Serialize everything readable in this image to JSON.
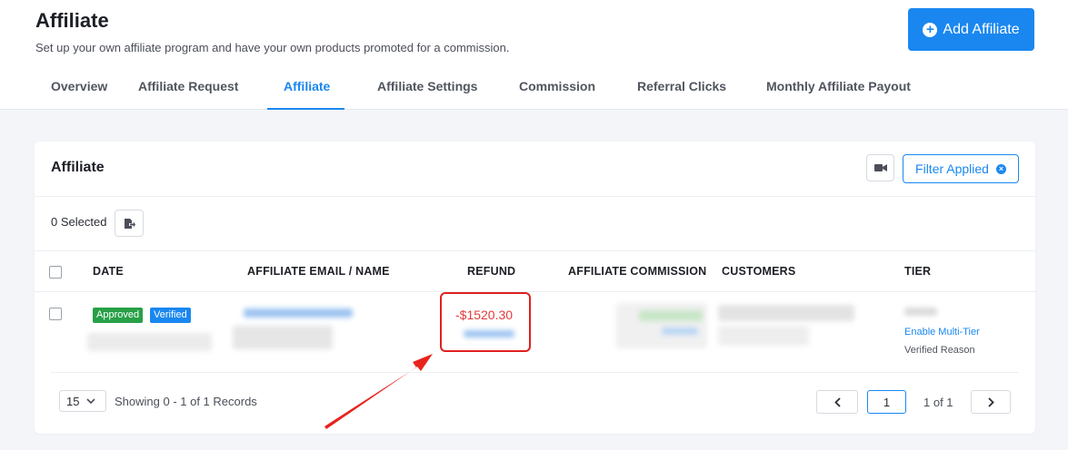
{
  "header": {
    "title": "Affiliate",
    "subtitle": "Set up your own affiliate program and have your own products promoted for a commission.",
    "add_button": "Add Affiliate",
    "tabs": [
      {
        "label": "Overview"
      },
      {
        "label": "Affiliate Request"
      },
      {
        "label": "Affiliate"
      },
      {
        "label": "Affiliate Settings"
      },
      {
        "label": "Commission"
      },
      {
        "label": "Referral Clicks"
      },
      {
        "label": "Monthly Affiliate Payout"
      }
    ],
    "active_tab": "Affiliate"
  },
  "card": {
    "title": "Affiliate",
    "filter_button": "Filter Applied",
    "selected_text": "0 Selected"
  },
  "table": {
    "columns": [
      "DATE",
      "AFFILIATE EMAIL / NAME",
      "REFUND",
      "AFFILIATE COMMISSION",
      "CUSTOMERS",
      "TIER"
    ],
    "rows": [
      {
        "badges": [
          "Approved",
          "Verified"
        ],
        "refund_amount": "-$1520.30",
        "tier_link": "Enable Multi-Tier",
        "tier_note": "Verified Reason"
      }
    ]
  },
  "pagination": {
    "per_page": "15",
    "showing": "Showing 0 - 1 of 1 Records",
    "current_page": "1",
    "of_text": "1 of 1"
  },
  "colors": {
    "accent": "#1a87f0",
    "approved": "#27a046",
    "refund": "#e23b3b",
    "highlight": "#e02020"
  }
}
